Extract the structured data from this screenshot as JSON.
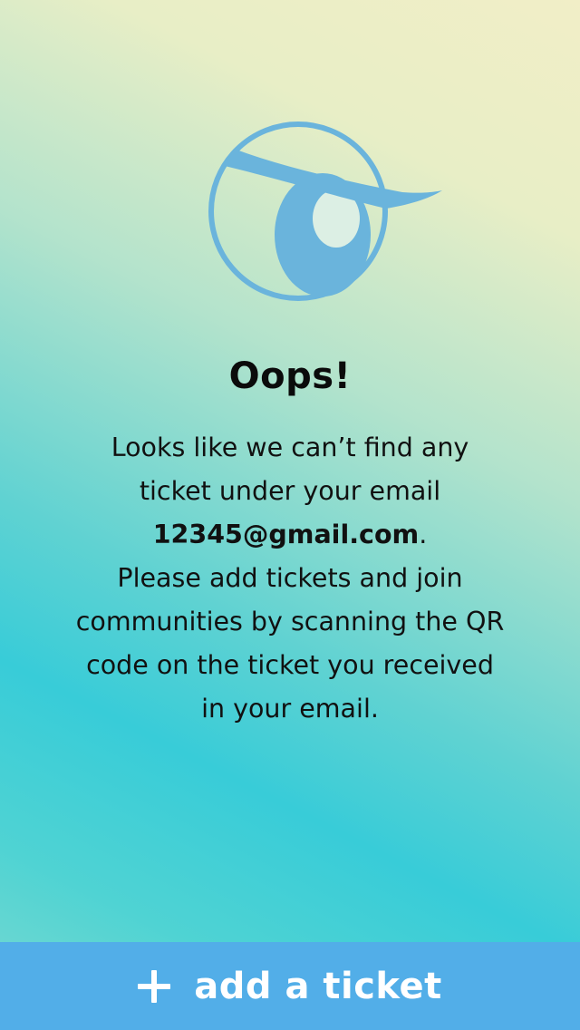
{
  "empty_state": {
    "mascot_icon": "eye-mascot-icon",
    "title": "Oops!",
    "message": {
      "line1": "Looks like we can’t find any",
      "line2": "ticket under your email",
      "email": "12345@gmail.com",
      "email_suffix": ".",
      "line4": "Please add tickets and join",
      "line5": "communities by scanning the QR",
      "line6": "code on the ticket you received",
      "line7": "in your email."
    }
  },
  "footer": {
    "add_ticket_label": "add a ticket",
    "add_icon": "plus-icon",
    "button_color": "#52aee8"
  },
  "colors": {
    "mascot": "#6ab4dc",
    "text": "#111111"
  }
}
